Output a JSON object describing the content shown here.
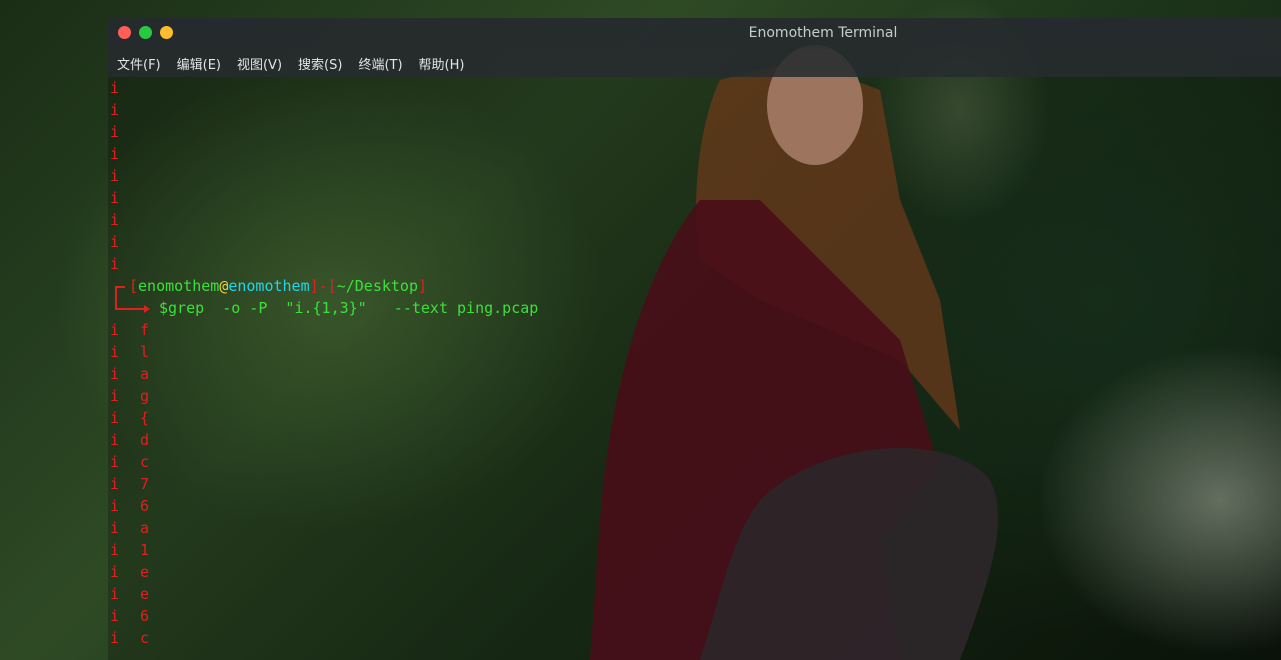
{
  "window": {
    "title": "Enomothem Terminal"
  },
  "menu": [
    {
      "label": "文件(F)"
    },
    {
      "label": "编辑(E)"
    },
    {
      "label": "视图(V)"
    },
    {
      "label": "搜索(S)"
    },
    {
      "label": "终端(T)"
    },
    {
      "label": "帮助(H)"
    }
  ],
  "terminal": {
    "previous_output": [
      "i",
      "i",
      "i",
      "i",
      "i",
      "i",
      "i",
      "i",
      "i"
    ],
    "prompt": {
      "open_bracket": "[",
      "user": "enomothem",
      "at": "@",
      "host": "enomothem",
      "close_bracket": "]",
      "separator": "-",
      "path_open": "[",
      "path": "~/Desktop",
      "path_close": "]"
    },
    "command": "$grep  -o -P  \"i.{1,3}\"   --text ping.pcap",
    "output_col1": [
      "i",
      "i",
      "i",
      "i",
      "i",
      "i",
      "i",
      "i",
      "i",
      "i",
      "i",
      "i",
      "i",
      "i",
      "i"
    ],
    "output_col2": [
      "f",
      "l",
      "a",
      "g",
      "{",
      "d",
      "c",
      "7",
      "6",
      "a",
      "1",
      "e",
      "e",
      "6",
      "c"
    ]
  },
  "colors": {
    "prompt_red": "#e0201e",
    "user_green": "#3ce03c",
    "host_cyan": "#1fd6e8",
    "at_yellow": "#e6d23a"
  }
}
